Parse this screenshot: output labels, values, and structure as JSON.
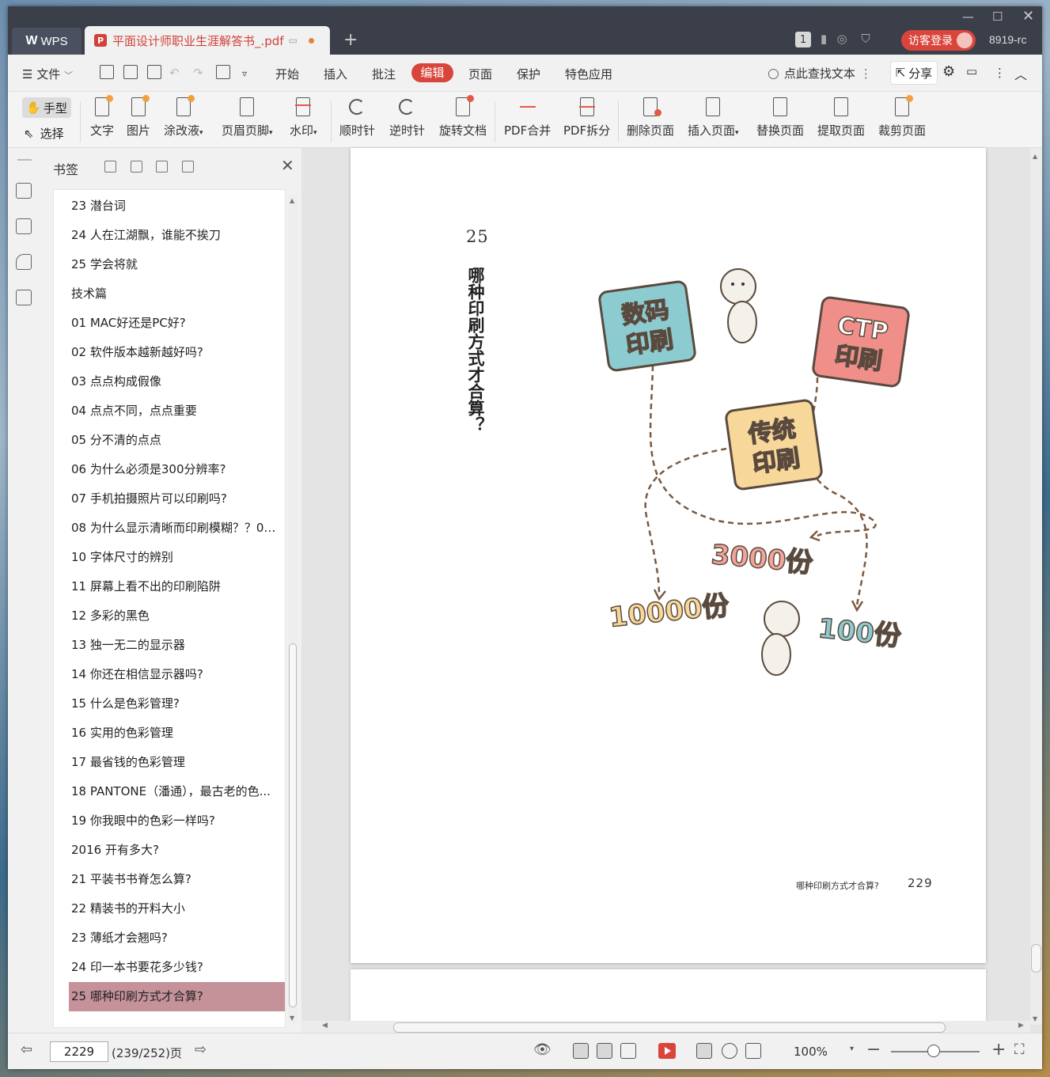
{
  "titlebar": {
    "app_name": "WPS",
    "doc_tab_title": "平面设计师职业生涯解答书_.pdf",
    "badge": "1",
    "login_label": "访客登录",
    "user_id": "8919-rc"
  },
  "menu": {
    "file": "文件",
    "items": [
      "开始",
      "插入",
      "批注",
      "编辑",
      "页面",
      "保护",
      "特色应用"
    ],
    "active": "编辑",
    "search_label": "点此查找文本",
    "share_label": "分享"
  },
  "toolbar": {
    "hand": "手型",
    "select": "选择",
    "tools": [
      "文字",
      "图片",
      "涂改液",
      "页眉页脚",
      "水印",
      "顺时针",
      "逆时针",
      "旋转文档",
      "PDF合并",
      "PDF拆分",
      "删除页面",
      "插入页面",
      "替换页面",
      "提取页面",
      "裁剪页面"
    ]
  },
  "bookmarks": {
    "title": "书签",
    "items": [
      "23 潜台词",
      "24 人在江湖飘，谁能不挨刀",
      "25 学会将就",
      "技术篇",
      "01 MAC好还是PC好?",
      "02 软件版本越新越好吗?",
      "03 点点构成假像",
      "04 点点不同，点点重要",
      "05 分不清的点点",
      "06 为什么必须是300分辨率?",
      "07 手机拍摄照片可以印刷吗?",
      "08 为什么显示清晰而印刷模糊？？09 ...",
      "10 字体尺寸的辨别",
      "11 屏幕上看不出的印刷陷阱",
      "12 多彩的黑色",
      "13 独一无二的显示器",
      "14 你还在相信显示器吗?",
      "15 什么是色彩管理?",
      "16 实用的色彩管理",
      "17 最省钱的色彩管理",
      "18 PANTONE（潘通），最古老的色...",
      "19 你我眼中的色彩一样吗?",
      "2016 开有多大?",
      "21 平装书书脊怎么算?",
      "22 精装书的开料大小",
      "23 薄纸才会翘吗?",
      "24 印一本书要花多少钱?",
      "25 哪种印刷方式才合算?"
    ],
    "selected_index": 27
  },
  "page": {
    "section_number": "25",
    "vertical_title": "哪种印刷方式才合算？",
    "illustration": {
      "card_digital": "数码印刷",
      "card_ctp": "CTP印刷",
      "card_traditional": "传统印刷",
      "qty_3000": "3000份",
      "qty_10000": "10000份",
      "qty_100": "100份"
    },
    "footer_title": "哪种印刷方式才合算?",
    "footer_number": "229"
  },
  "status": {
    "page_input": "2229",
    "page_info": "(239/252)页",
    "zoom": "100%"
  },
  "colors": {
    "accent": "#d9453b",
    "selected_bookmark": "#c5929a",
    "title_bar": "#3b3f4a"
  }
}
